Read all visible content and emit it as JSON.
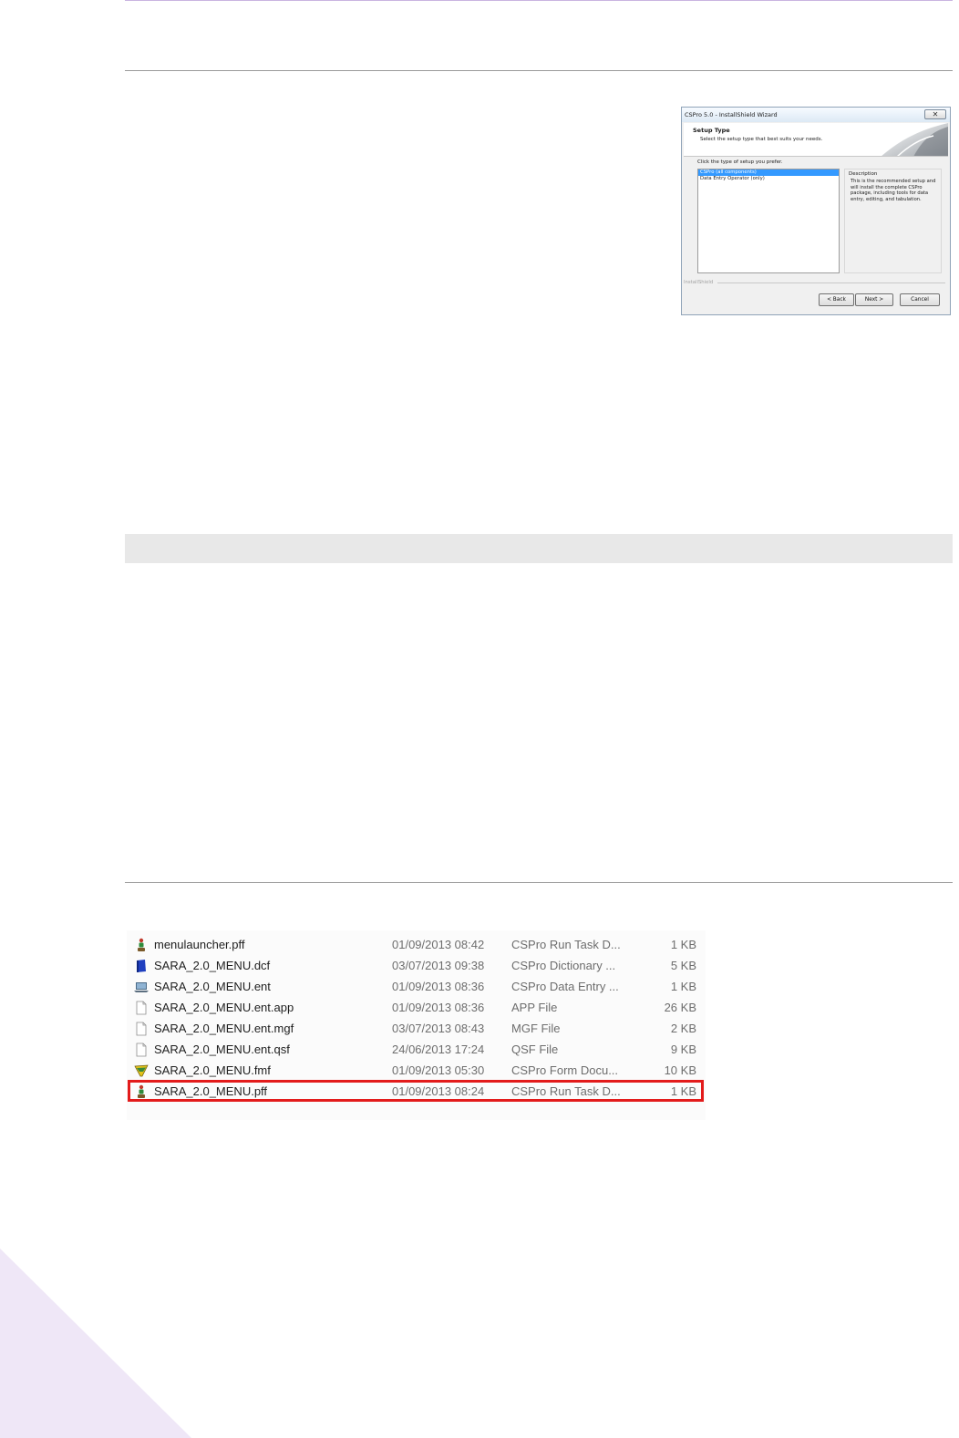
{
  "wizard": {
    "title": "CSPro 5.0 - InstallShield Wizard",
    "close_label": "✕",
    "heading": "Setup Type",
    "subheading": "Select the setup type that best suits your needs.",
    "prompt": "Click the type of setup you prefer.",
    "options": [
      {
        "label": "CSPro (all components)",
        "selected": true
      },
      {
        "label": "Data Entry Operator (only)",
        "selected": false
      }
    ],
    "description_title": "Description",
    "description_text": "This is the recommended setup and will install the complete CSPro package, including tools for data entry, editing, and tabulation.",
    "footer_label": "InstallShield",
    "back_label": "< Back",
    "next_label": "Next >",
    "cancel_label": "Cancel"
  },
  "files": [
    {
      "name": "menulauncher.pff",
      "date": "01/09/2013 08:42",
      "type": "CSPro Run Task D...",
      "size": "1 KB",
      "icon": "pff-run-task-icon"
    },
    {
      "name": "SARA_2.0_MENU.dcf",
      "date": "03/07/2013 09:38",
      "type": "CSPro Dictionary ...",
      "size": "5 KB",
      "icon": "dictionary-book-icon"
    },
    {
      "name": "SARA_2.0_MENU.ent",
      "date": "01/09/2013 08:36",
      "type": "CSPro Data Entry ...",
      "size": "1 KB",
      "icon": "data-entry-laptop-icon"
    },
    {
      "name": "SARA_2.0_MENU.ent.app",
      "date": "01/09/2013 08:36",
      "type": "APP File",
      "size": "26 KB",
      "icon": "blank-file-icon"
    },
    {
      "name": "SARA_2.0_MENU.ent.mgf",
      "date": "03/07/2013 08:43",
      "type": "MGF File",
      "size": "2 KB",
      "icon": "blank-file-icon"
    },
    {
      "name": "SARA_2.0_MENU.ent.qsf",
      "date": "24/06/2013 17:24",
      "type": "QSF File",
      "size": "9 KB",
      "icon": "blank-file-icon"
    },
    {
      "name": "SARA_2.0_MENU.fmf",
      "date": "01/09/2013 05:30",
      "type": "CSPro Form Docu...",
      "size": "10 KB",
      "icon": "form-document-icon"
    },
    {
      "name": "SARA_2.0_MENU.pff",
      "date": "01/09/2013 08:24",
      "type": "CSPro Run Task D...",
      "size": "1 KB",
      "icon": "pff-run-task-icon",
      "highlighted": true
    }
  ],
  "colors": {
    "highlight": "#e31b1b",
    "selection": "#3399ff",
    "accent_lavender": "#efe7f7"
  }
}
